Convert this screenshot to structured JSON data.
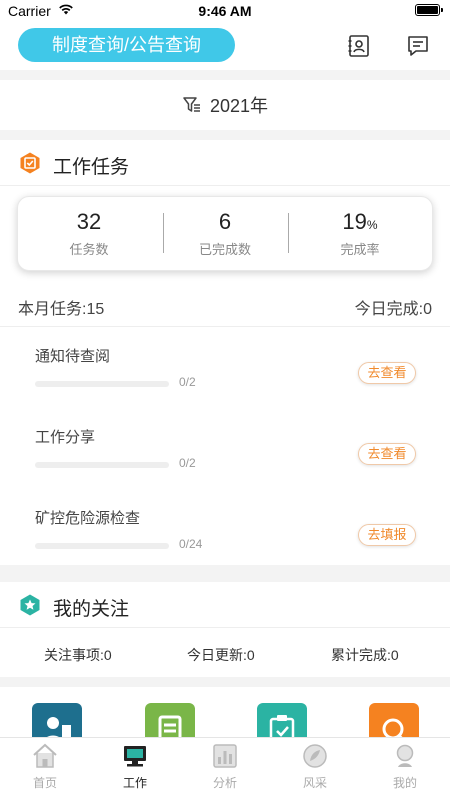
{
  "status_bar": {
    "carrier": "Carrier",
    "time": "9:46 AM"
  },
  "header": {
    "search_label": "制度查询/公告查询"
  },
  "year_filter": {
    "year": "2021年"
  },
  "tasks": {
    "title": "工作任务",
    "stats": [
      {
        "value": "32",
        "unit": "",
        "label": "任务数"
      },
      {
        "value": "6",
        "unit": "",
        "label": "已完成数"
      },
      {
        "value": "19",
        "unit": "%",
        "label": "完成率"
      }
    ],
    "month_tasks": "本月任务:15",
    "today_done": "今日完成:0",
    "items": [
      {
        "name": "通知待查阅",
        "count": "0/2",
        "progress": 0,
        "action": "去查看"
      },
      {
        "name": "工作分享",
        "count": "0/2",
        "progress": 0,
        "action": "去查看"
      },
      {
        "name": "矿控危险源检查",
        "count": "0/24",
        "progress": 0,
        "action": "去填报"
      }
    ]
  },
  "follow": {
    "title": "我的关注",
    "items": [
      "关注事项:0",
      "今日更新:0",
      "累计完成:0"
    ]
  },
  "apps": {
    "colors": [
      "#1e6f8e",
      "#7ab648",
      "#2bb3a3",
      "#f58220"
    ]
  },
  "tab_bar": {
    "tabs": [
      {
        "label": "首页",
        "icon": "home-icon"
      },
      {
        "label": "工作",
        "icon": "work-icon"
      },
      {
        "label": "分析",
        "icon": "analysis-icon"
      },
      {
        "label": "风采",
        "icon": "style-icon"
      },
      {
        "label": "我的",
        "icon": "profile-icon"
      }
    ],
    "active_index": 1
  },
  "colors": {
    "accent": "#40c8e8",
    "orange": "#f08a2c",
    "task_icon": "#f58220",
    "follow_icon": "#2bb3a3"
  }
}
